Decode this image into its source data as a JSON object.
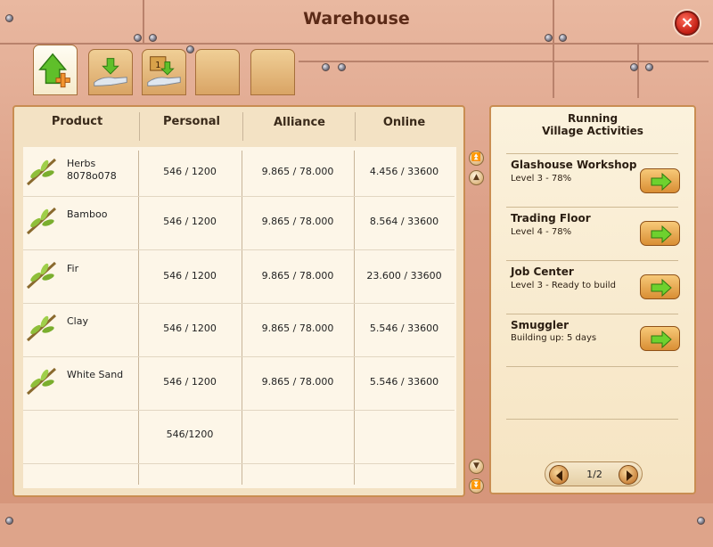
{
  "window": {
    "title": "Warehouse",
    "close_icon": "close-icon"
  },
  "tabs": [
    {
      "name": "tab-add",
      "icon": "green-arrow-plus-icon",
      "active": true
    },
    {
      "name": "tab-deposit",
      "icon": "hand-down-arrow-icon",
      "active": false
    },
    {
      "name": "tab-withdraw",
      "icon": "box-hand-icon",
      "active": false
    },
    {
      "name": "tab-empty-1",
      "icon": "",
      "active": false
    },
    {
      "name": "tab-empty-2",
      "icon": "",
      "active": false
    }
  ],
  "table": {
    "headers": [
      "Product",
      "Personal",
      "Alliance",
      "Online"
    ],
    "rows": [
      {
        "name": "Herbs",
        "name2": "8078o078",
        "personal": "546 / 1200",
        "alliance": "9.865 / 78.000",
        "online": "4.456 / 33600"
      },
      {
        "name": "Bamboo",
        "name2": "",
        "personal": "546 / 1200",
        "alliance": "9.865 / 78.000",
        "online": "8.564 / 33600"
      },
      {
        "name": "Fir",
        "name2": "",
        "personal": "546 / 1200",
        "alliance": "9.865 / 78.000",
        "online": "23.600 / 33600"
      },
      {
        "name": "Clay",
        "name2": "",
        "personal": "546 / 1200",
        "alliance": "9.865 / 78.000",
        "online": "5.546 / 33600"
      },
      {
        "name": "White Sand",
        "name2": "",
        "personal": "546 / 1200",
        "alliance": "9.865 / 78.000",
        "online": "5.546 / 33600"
      }
    ],
    "footer_personal": "546/1200"
  },
  "side": {
    "title_line1": "Running",
    "title_line2": "Village Activities",
    "activities": [
      {
        "name": "Glashouse Workshop",
        "status": "Level 3 - 78%"
      },
      {
        "name": "Trading Floor",
        "status": "Level 4 - 78%"
      },
      {
        "name": "Job Center",
        "status": "Level 3 - Ready to build"
      },
      {
        "name": "Smuggler",
        "status": "Building up: 5 days"
      }
    ],
    "pager": "1/2"
  },
  "colors": {
    "accent_green": "#5fbf2a",
    "wood": "#d9a465",
    "frame": "#dca088"
  }
}
